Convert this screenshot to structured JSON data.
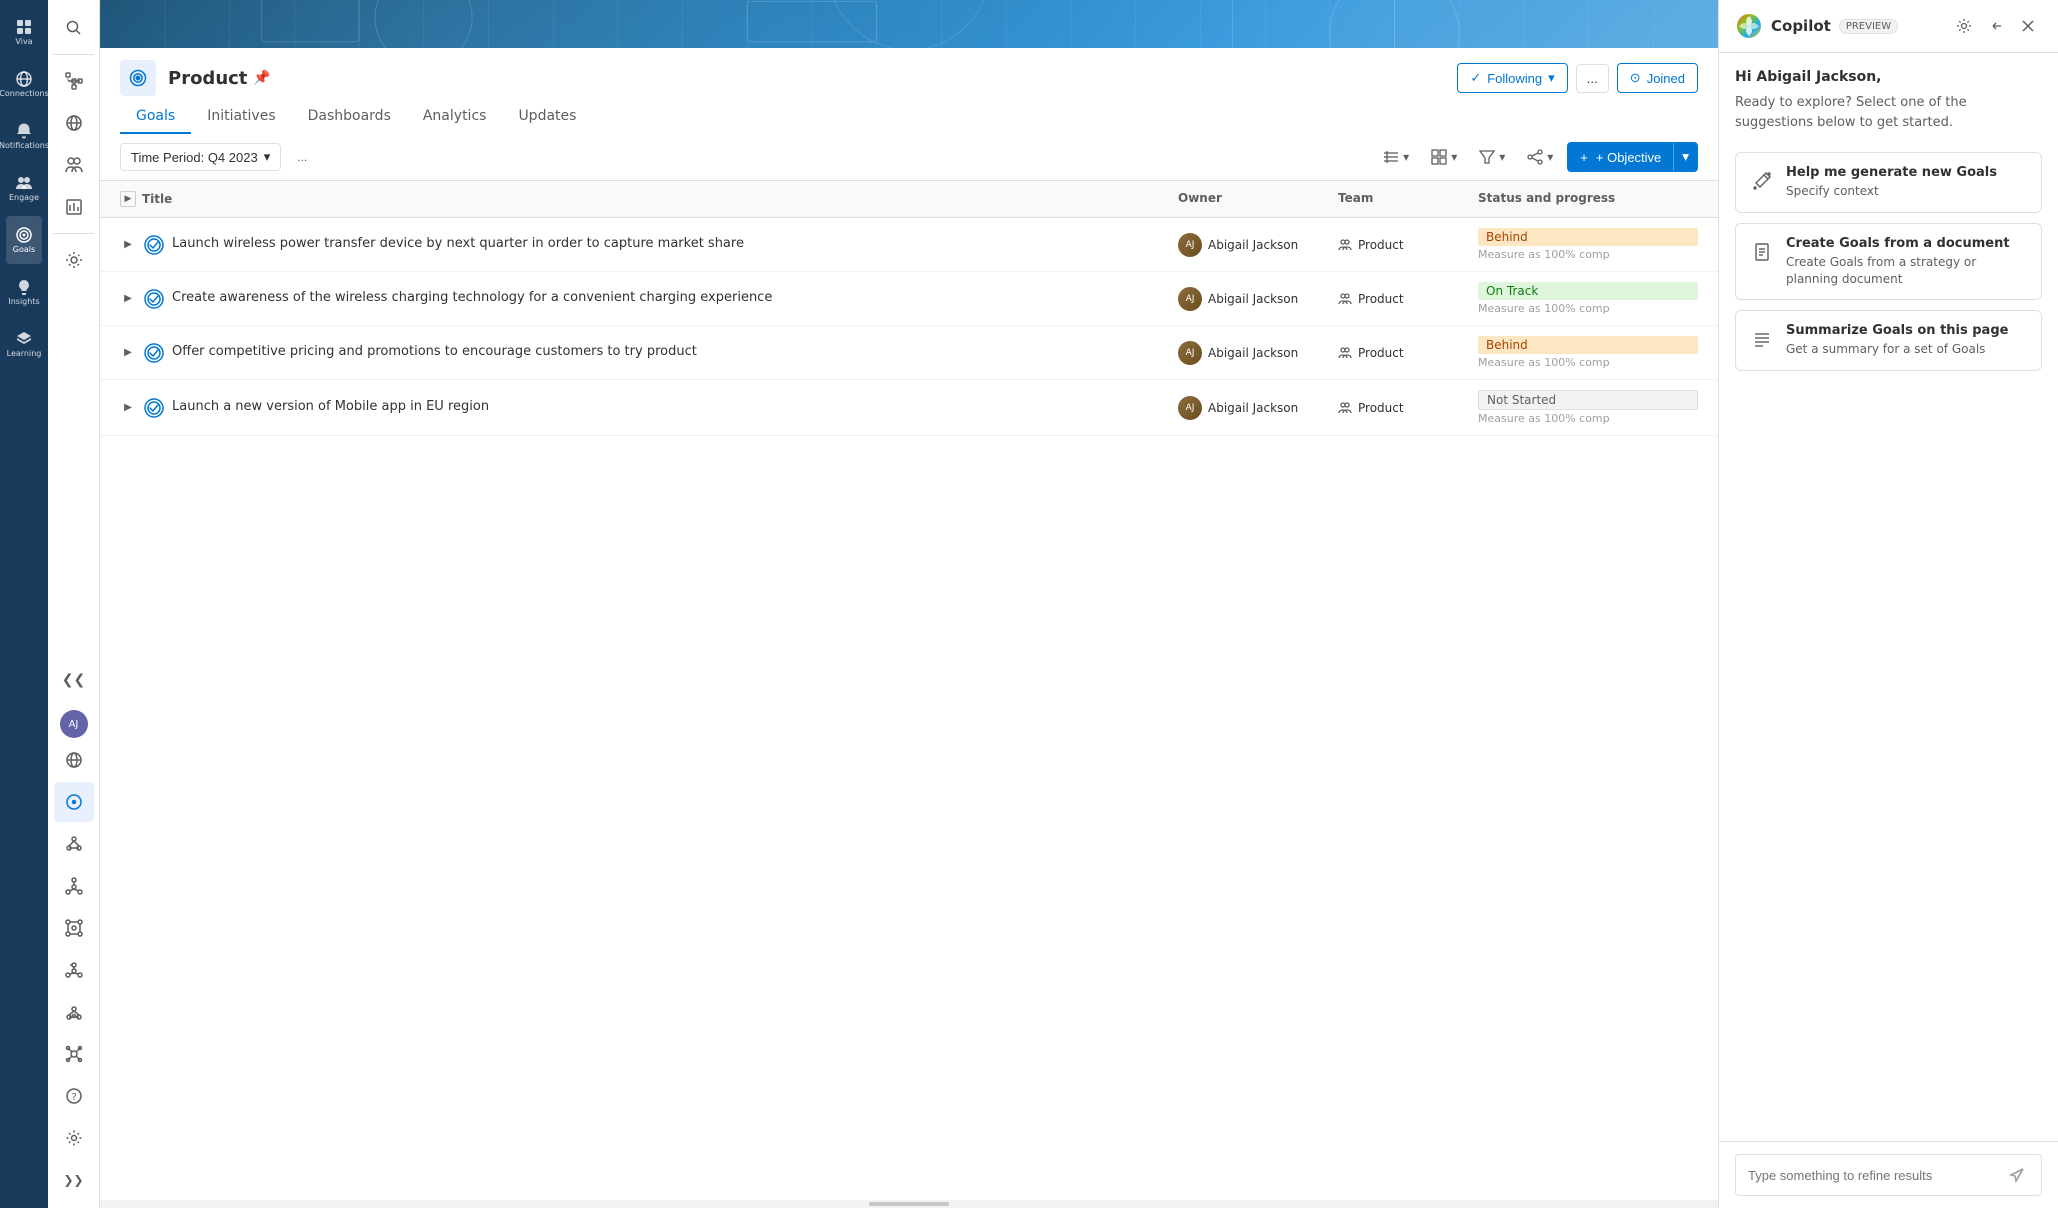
{
  "farLeftNav": {
    "items": [
      {
        "id": "viva",
        "label": "Viva",
        "icon": "grid"
      },
      {
        "id": "connections",
        "label": "Connections",
        "icon": "globe"
      },
      {
        "id": "notifications",
        "label": "Notifications",
        "icon": "bell"
      },
      {
        "id": "engage",
        "label": "Engage",
        "icon": "people"
      },
      {
        "id": "goals",
        "label": "Goals",
        "icon": "target",
        "active": true
      },
      {
        "id": "insights",
        "label": "Insights",
        "icon": "lightbulb"
      },
      {
        "id": "learning",
        "label": "Learning",
        "icon": "book"
      }
    ]
  },
  "leftSidebar": {
    "icons": [
      "search",
      "hierarchy",
      "people",
      "grid",
      "settings"
    ]
  },
  "header": {
    "bannerAlt": "Blueprint background banner",
    "pageIconAlt": "Goals icon",
    "title": "Product",
    "pinIcon": "📌",
    "tabs": [
      "Goals",
      "Initiatives",
      "Dashboards",
      "Analytics",
      "Updates"
    ],
    "activeTab": "Goals",
    "followingLabel": "Following",
    "joinedLabel": "Joined",
    "moreLabel": "..."
  },
  "toolbar": {
    "timePeriod": "Time Period: Q4 2023",
    "moreOptions": "...",
    "objectiveLabel": "+ Objective",
    "viewIcons": [
      "arrow-right",
      "grid",
      "filter",
      "share"
    ]
  },
  "table": {
    "columns": [
      "Title",
      "Owner",
      "Team",
      "Status and progress"
    ],
    "rows": [
      {
        "id": 1,
        "title": "Launch wireless power transfer device by next quarter in order to capture market share",
        "owner": "Abigail Jackson",
        "team": "Product",
        "status": "Behind",
        "statusType": "behind",
        "measure": "Measure as 100% comp"
      },
      {
        "id": 2,
        "title": "Create awareness of the wireless charging technology for a convenient charging experience",
        "owner": "Abigail Jackson",
        "team": "Product",
        "status": "On Track",
        "statusType": "on-track",
        "measure": "Measure as 100% comp"
      },
      {
        "id": 3,
        "title": "Offer competitive pricing and promotions to encourage customers to try product",
        "owner": "Abigail Jackson",
        "team": "Product",
        "status": "Behind",
        "statusType": "behind",
        "measure": "Measure as 100% comp"
      },
      {
        "id": 4,
        "title": "Launch a new version of Mobile app in EU region",
        "owner": "Abigail Jackson",
        "team": "Product",
        "status": "Not Started",
        "statusType": "not-started",
        "measure": "Measure as 100% comp"
      }
    ]
  },
  "copilot": {
    "name": "Copilot",
    "previewLabel": "PREVIEW",
    "greeting": "Hi Abigail Jackson,",
    "intro": "Ready to explore? Select one of the suggestions below to get started.",
    "suggestions": [
      {
        "id": "generate",
        "icon": "wand",
        "title": "Help me generate new Goals",
        "description": "Specify context"
      },
      {
        "id": "create-from-doc",
        "icon": "document",
        "title": "Create Goals from a document",
        "description": "Create Goals from a strategy or planning document"
      },
      {
        "id": "summarize",
        "icon": "list",
        "title": "Summarize Goals on this page",
        "description": "Get a summary for a set of Goals"
      }
    ],
    "inputPlaceholder": "Type something to refine results"
  }
}
